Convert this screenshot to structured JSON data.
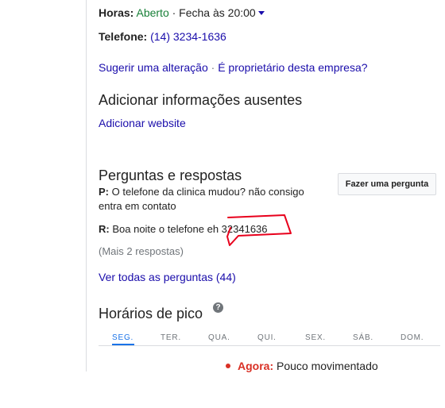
{
  "info": {
    "hours_label": "Horas:",
    "hours_status": "Aberto",
    "hours_close": "· Fecha às 20:00",
    "phone_label": "Telefone:",
    "phone_value": "(14) 3234-1636",
    "suggest_edit": "Sugerir uma alteração",
    "separator": "·",
    "owner_link": "É proprietário desta empresa?"
  },
  "missing_info": {
    "title": "Adicionar informações ausentes",
    "add_website": "Adicionar website"
  },
  "qa": {
    "title": "Perguntas e respostas",
    "ask_button": "Fazer uma pergunta",
    "question_prefix": "P:",
    "question_text": "O telefone da clinica mudou? não consigo entra em contato",
    "answer_prefix": "R:",
    "answer_text": "Boa noite o telefone eh 32341636",
    "more_answers": "(Mais 2 respostas)",
    "view_all": "Ver todas as perguntas (44)"
  },
  "peak_hours": {
    "title": "Horários de pico",
    "help_glyph": "?",
    "days": [
      "SEG.",
      "TER.",
      "QUA.",
      "QUI.",
      "SEX.",
      "SÁB.",
      "DOM."
    ],
    "selected_day": "SEG.",
    "now_label": "Agora:",
    "now_status": "Pouco movimentado"
  },
  "colors": {
    "link": "#1a0dab",
    "open_green": "#188038",
    "accent_blue": "#1a73e8",
    "live_red": "#d93025",
    "annotation_red": "#e8001c"
  }
}
